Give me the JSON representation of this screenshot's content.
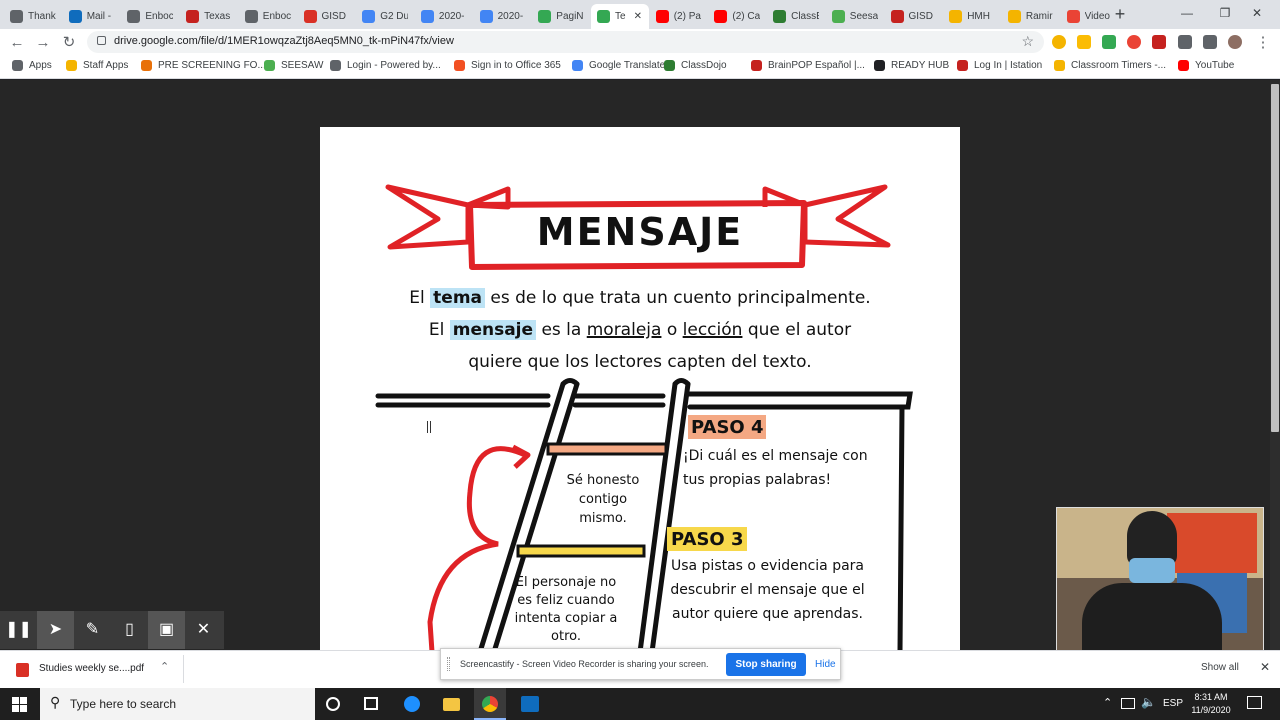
{
  "tabs": [
    {
      "label": "Thank",
      "color": "#5f6368"
    },
    {
      "label": "Mail -",
      "color": "#0f6cbd"
    },
    {
      "label": "Enboc",
      "color": "#5f6368"
    },
    {
      "label": "Texas",
      "color": "#c5221f"
    },
    {
      "label": "Enboc",
      "color": "#5f6368"
    },
    {
      "label": "GISD",
      "color": "#d93025"
    },
    {
      "label": "G2 Du",
      "color": "#4285f4"
    },
    {
      "label": "2020-",
      "color": "#4285f4"
    },
    {
      "label": "2020-",
      "color": "#4285f4"
    },
    {
      "label": "PagiN",
      "color": "#34a853"
    },
    {
      "label": "Te",
      "color": "#34a853"
    },
    {
      "label": "(2) Pa",
      "color": "#ff0000"
    },
    {
      "label": "(2) Ca",
      "color": "#ff0000"
    },
    {
      "label": "ClassE",
      "color": "#2e7d32"
    },
    {
      "label": "Seesa",
      "color": "#4caf50"
    },
    {
      "label": "GISD",
      "color": "#c5221f"
    },
    {
      "label": "HMH",
      "color": "#f4b400"
    },
    {
      "label": "Ramir",
      "color": "#f4b400"
    },
    {
      "label": "Video",
      "color": "#ea4335"
    }
  ],
  "url": "drive.google.com/file/d/1MER1owqzaZtj8Aeq5MN0_tk-mPiN47fx/view",
  "bookmarks": [
    {
      "label": "Apps",
      "color": "#5f6368"
    },
    {
      "label": "Staff Apps",
      "color": "#f4b400"
    },
    {
      "label": "PRE SCREENING FO...",
      "color": "#e8710a"
    },
    {
      "label": "SEESAW",
      "color": "#4caf50"
    },
    {
      "label": "Login - Powered by...",
      "color": "#5f6368"
    },
    {
      "label": "Sign in to Office 365",
      "color": "#f25022"
    },
    {
      "label": "Google Translate",
      "color": "#4285f4"
    },
    {
      "label": "ClassDojo",
      "color": "#2e7d32"
    },
    {
      "label": "BrainPOP Español |...",
      "color": "#c5221f"
    },
    {
      "label": "READY HUB",
      "color": "#202124"
    },
    {
      "label": "Log In | Istation",
      "color": "#c5221f"
    },
    {
      "label": "Classroom Timers -...",
      "color": "#f4b400"
    },
    {
      "label": "YouTube",
      "color": "#ff0000"
    }
  ],
  "poster": {
    "title": "MENSAJE",
    "line1": {
      "a": "El",
      "b": "tema",
      "c": "es de lo que trata un cuento principalmente."
    },
    "line2": {
      "a": "El",
      "b": "mensaje",
      "c": "es la",
      "d": "moraleja",
      "e": "o",
      "f": "lección",
      "g": "que el autor"
    },
    "line3": "quiere que los lectores capten del texto.",
    "paso4_title": "PASO 4",
    "paso4_text": "¡Di cuál es el mensaje con tus propias palabras!",
    "paso3_title": "PASO 3",
    "paso3_text": "Usa pistas o evidencia para descubrir el mensaje que el autor quiere que aprendas.",
    "rung1_text": "Sé honesto contigo mismo.",
    "rung2_text": "El personaje no es feliz cuando intenta copiar a otro."
  },
  "download": {
    "filename": "Studies weekly se....pdf",
    "show_all": "Show all"
  },
  "share": {
    "text": "Screencastify - Screen Video Recorder is sharing your screen.",
    "stop": "Stop sharing",
    "hide": "Hide"
  },
  "taskbar": {
    "search_placeholder": "Type here to search",
    "lang": "ESP",
    "time": "8:31 AM",
    "date": "11/9/2020"
  },
  "colors": {
    "ribbon": "#e02226",
    "paso4": "#f4a883",
    "paso3": "#f7d84b",
    "highlight": "#bde3f5",
    "accent": "#1a73e8"
  }
}
